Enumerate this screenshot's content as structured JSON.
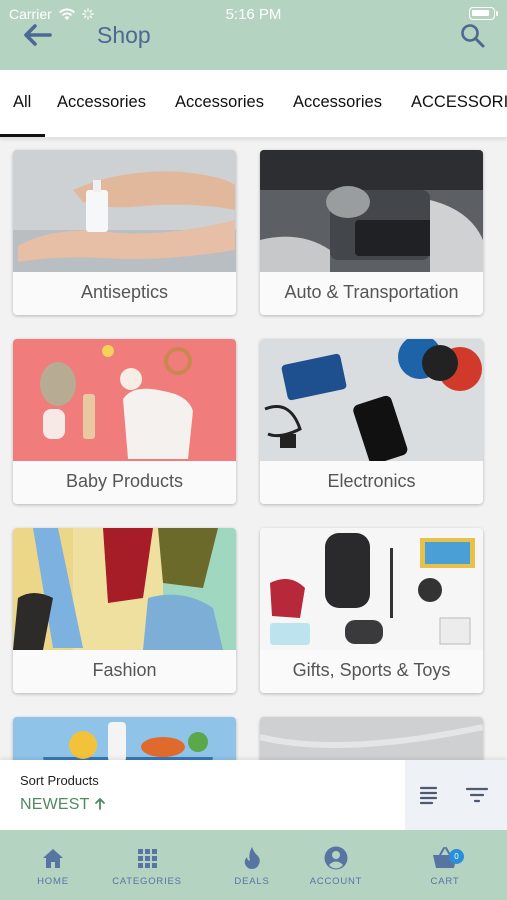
{
  "status_bar": {
    "carrier": "Carrier",
    "time": "5:16 PM"
  },
  "header": {
    "title": "Shop"
  },
  "tabs": [
    {
      "label": "All",
      "active": true
    },
    {
      "label": "Accessories"
    },
    {
      "label": "Accessories"
    },
    {
      "label": "Accessories"
    },
    {
      "label": "ACCESSORIES"
    }
  ],
  "categories": [
    {
      "label": "Antiseptics",
      "image": "hand-sanitizer-photo"
    },
    {
      "label": "Auto & Transportation",
      "image": "car-interior-photo"
    },
    {
      "label": "Baby Products",
      "image": "baby-items-photo"
    },
    {
      "label": "Electronics",
      "image": "electronics-photo"
    },
    {
      "label": "Fashion",
      "image": "clothing-photo"
    },
    {
      "label": "Gifts, Sports & Toys",
      "image": "gifts-toys-photo"
    },
    {
      "label": "",
      "image": "groceries-photo"
    },
    {
      "label": "",
      "image": "marble-photo"
    }
  ],
  "sort": {
    "title": "Sort Products",
    "value": "NEWEST",
    "direction_icon": "arrow-up-icon"
  },
  "bottom_nav": [
    {
      "label": "HOME",
      "icon": "home-icon"
    },
    {
      "label": "CATEGORIES",
      "icon": "grid-icon"
    },
    {
      "label": "DEALS",
      "icon": "flame-icon"
    },
    {
      "label": "ACCOUNT",
      "icon": "account-icon"
    },
    {
      "label": "CART",
      "icon": "basket-icon",
      "badge": "0"
    }
  ],
  "colors": {
    "header_bg": "#b4d3c1",
    "title": "#4d6891",
    "sort_accent": "#4f8a62",
    "nav_label": "#5874a3",
    "badge": "#2a8fd8"
  }
}
